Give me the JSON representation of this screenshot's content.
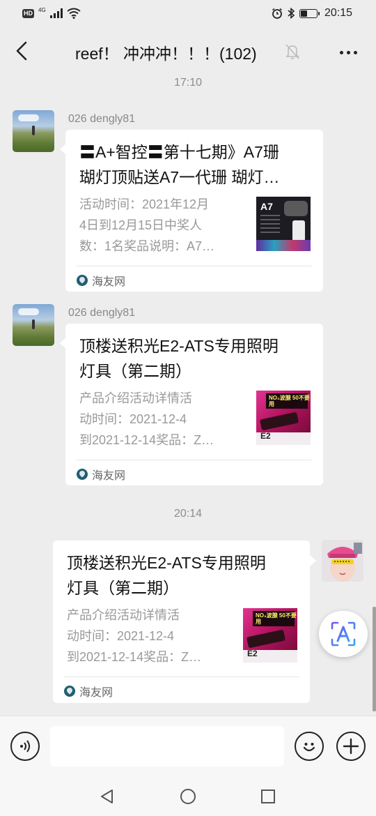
{
  "status_bar": {
    "left_badge": "HD",
    "network": "4G",
    "time": "20:15",
    "battery_level": 0.4
  },
  "header": {
    "title": "reef！ 冲冲冲！！！(102)",
    "back_icon": "chevron-left-icon",
    "mute_icon": "bell-muted-icon",
    "more_icon": "more-dots-icon"
  },
  "messages": [
    {
      "timestamp": "17:10"
    },
    {
      "sender": "026 dengly81",
      "card": {
        "title_line1": "〓A+智控〓第十七期》A7珊",
        "title_line2": "瑚灯顶贴送A7一代珊 瑚灯…",
        "desc_line1": "活动时间：2021年12月",
        "desc_line2": "4日到12月15日中奖人",
        "desc_line3": "数：1名奖品说明：A7…",
        "thumb_label": "A7",
        "source": "海友网"
      }
    },
    {
      "sender": "026 dengly81",
      "card": {
        "title_line1": "顶楼送积光E2-ATS专用照明",
        "title_line2": "灯具（第二期）",
        "desc_line1": "产品介绍活动详情活",
        "desc_line2": "动时间：2021-12-4",
        "desc_line3": "到2021-12-14奖品：Z…",
        "thumb_label": "E2",
        "thumb_banner": "NO₃波腺 50不要用",
        "source": "海友网"
      }
    },
    {
      "timestamp": "20:14"
    },
    {
      "sender": "me",
      "card": {
        "title_line1": "顶楼送积光E2-ATS专用照明",
        "title_line2": "灯具（第二期）",
        "desc_line1": "产品介绍活动详情活",
        "desc_line2": "动时间：2021-12-4",
        "desc_line3": "到2021-12-14奖品：Z…",
        "thumb_label": "E2",
        "thumb_banner": "NO₃波腺 50不要用",
        "source": "海友网"
      }
    }
  ],
  "input_bar": {
    "voice_icon": "voice-icon",
    "emoji_icon": "emoji-icon",
    "add_icon": "plus-icon",
    "input_value": ""
  },
  "floating": {
    "icon": "text-recognition-icon"
  },
  "nav": {
    "back": "nav-back-icon",
    "home": "nav-home-icon",
    "recent": "nav-recent-icon"
  },
  "colors": {
    "background": "#ededed",
    "card": "#ffffff",
    "muted_text": "#999999",
    "accent": "#4a6cf7"
  }
}
